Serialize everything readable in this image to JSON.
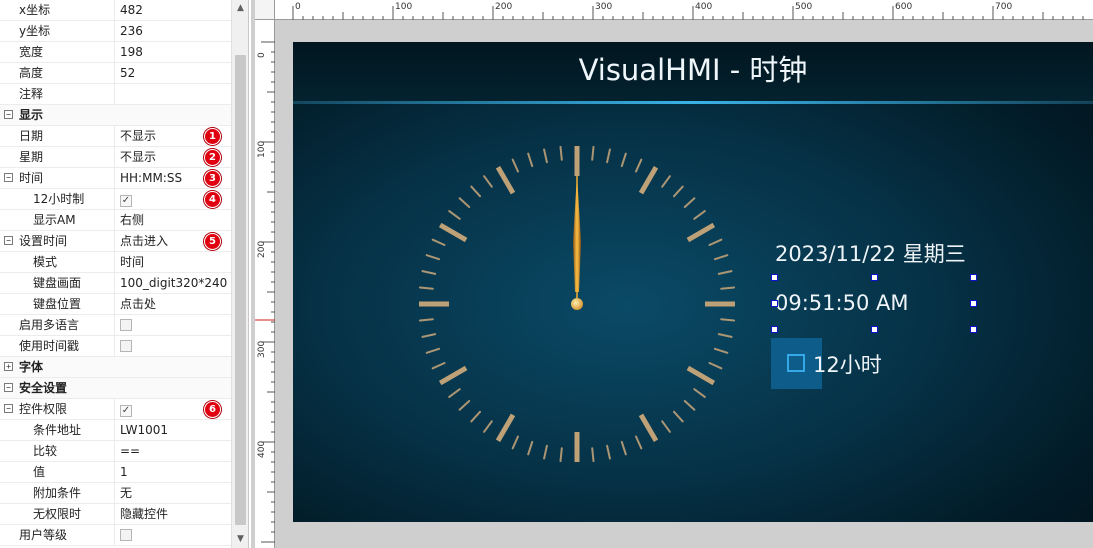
{
  "properties": {
    "rows": [
      {
        "name": "x坐标",
        "value": "482",
        "type": "text"
      },
      {
        "name": "y坐标",
        "value": "236",
        "type": "text"
      },
      {
        "name": "宽度",
        "value": "198",
        "type": "text"
      },
      {
        "name": "高度",
        "value": "52",
        "type": "text"
      },
      {
        "name": "注释",
        "value": "",
        "type": "text"
      },
      {
        "name": "显示",
        "type": "group",
        "expanded": true
      },
      {
        "name": "日期",
        "value": "不显示",
        "type": "text",
        "badge": "1"
      },
      {
        "name": "星期",
        "value": "不显示",
        "type": "text",
        "badge": "2"
      },
      {
        "name": "时间",
        "value": "HH:MM:SS",
        "type": "text",
        "badge": "3",
        "expandable": true
      },
      {
        "name": "12小时制",
        "type": "check",
        "checked": true,
        "indent": true,
        "badge": "4"
      },
      {
        "name": "显示AM",
        "value": "右侧",
        "type": "text",
        "indent": true
      },
      {
        "name": "设置时间",
        "value": "点击进入",
        "type": "text",
        "badge": "5",
        "expandable": true
      },
      {
        "name": "模式",
        "value": "时间",
        "type": "text",
        "indent": true
      },
      {
        "name": "键盘画面",
        "value": "100_digit320*240",
        "type": "text",
        "indent": true
      },
      {
        "name": "键盘位置",
        "value": "点击处",
        "type": "text",
        "indent": true
      },
      {
        "name": "启用多语言",
        "type": "check",
        "checked": false
      },
      {
        "name": "使用时间戳",
        "type": "check",
        "checked": false
      },
      {
        "name": "字体",
        "type": "group",
        "expanded": false
      },
      {
        "name": "安全设置",
        "type": "group",
        "expanded": true
      },
      {
        "name": "控件权限",
        "type": "check",
        "checked": true,
        "badge": "6",
        "expandable": true
      },
      {
        "name": "条件地址",
        "value": "LW1001",
        "type": "text",
        "indent": true
      },
      {
        "name": "比较",
        "value": "==",
        "type": "text",
        "indent": true
      },
      {
        "name": "值",
        "value": "1",
        "type": "text",
        "indent": true
      },
      {
        "name": "附加条件",
        "value": "无",
        "type": "text",
        "indent": true
      },
      {
        "name": "无权限时",
        "value": "隐藏控件",
        "type": "text",
        "indent": true
      },
      {
        "name": "用户等级",
        "type": "check",
        "checked": false
      }
    ]
  },
  "ruler": {
    "top_labels": [
      "0",
      "100",
      "200",
      "300",
      "400",
      "500",
      "600",
      "700"
    ],
    "left_labels": [
      "0",
      "100",
      "200",
      "300",
      "400"
    ]
  },
  "screen": {
    "title": "VisualHMI - 时钟",
    "date": "2023/11/22 星期三",
    "time": "09:51:50 AM",
    "hour_toggle_label": "12小时"
  },
  "colors": {
    "badge": "#e00010",
    "accent_line": "#3ab2e6",
    "clock_tick": "#c9a77a",
    "hand": "#e6a020",
    "selection_handle": "#1010d0"
  }
}
